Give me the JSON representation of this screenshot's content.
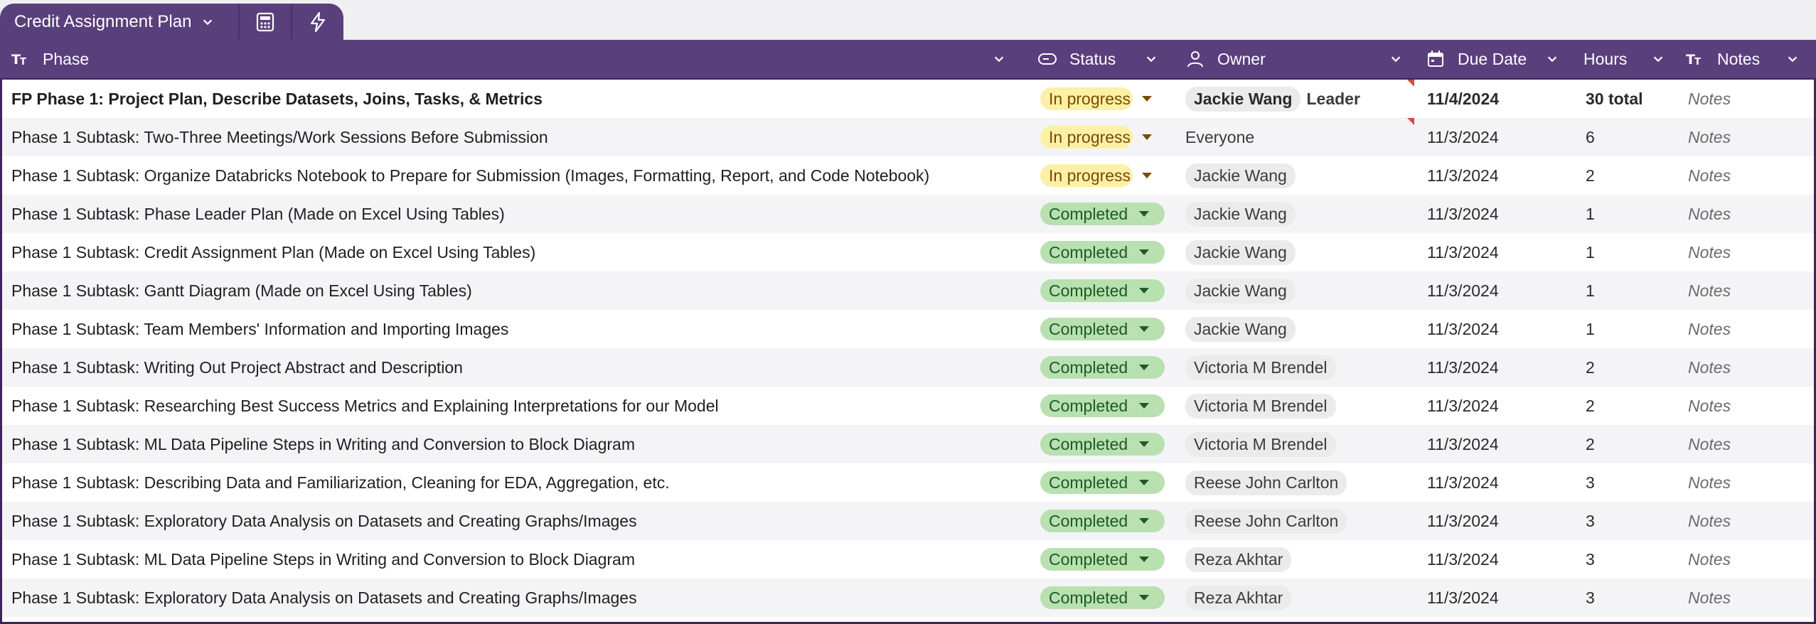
{
  "tab": {
    "title": "Credit Assignment Plan"
  },
  "columns": {
    "phase": "Phase",
    "status": "Status",
    "owner": "Owner",
    "due_date": "Due Date",
    "hours": "Hours",
    "notes": "Notes"
  },
  "colors": {
    "header_bg": "#5a3f7d",
    "in_progress_bg": "#fbf0a6",
    "completed_bg": "#b8e0b0"
  },
  "rows": [
    {
      "phase": "FP Phase 1: Project Plan, Describe Datasets, Joins, Tasks, & Metrics",
      "status": "In progress",
      "owner": "Jackie Wang",
      "owner_extra": "Leader",
      "due": "11/4/2024",
      "hours": "30 total",
      "notes": "Notes"
    },
    {
      "phase": "Phase 1 Subtask: Two-Three Meetings/Work Sessions Before Submission",
      "status": "In progress",
      "owner": "Everyone",
      "due": "11/3/2024",
      "hours": "6",
      "notes": "Notes"
    },
    {
      "phase": "Phase 1 Subtask: Organize Databricks Notebook to Prepare for Submission (Images, Formatting, Report, and Code Notebook)",
      "status": "In progress",
      "owner": "Jackie Wang",
      "due": "11/3/2024",
      "hours": "2",
      "notes": "Notes"
    },
    {
      "phase": "Phase 1 Subtask: Phase Leader Plan (Made on Excel Using Tables)",
      "status": "Completed",
      "owner": "Jackie Wang",
      "due": "11/3/2024",
      "hours": "1",
      "notes": "Notes"
    },
    {
      "phase": "Phase 1 Subtask: Credit Assignment Plan (Made on Excel Using Tables)",
      "status": "Completed",
      "owner": "Jackie Wang",
      "due": "11/3/2024",
      "hours": "1",
      "notes": "Notes"
    },
    {
      "phase": "Phase 1 Subtask: Gantt Diagram (Made on Excel Using Tables)",
      "status": "Completed",
      "owner": "Jackie Wang",
      "due": "11/3/2024",
      "hours": "1",
      "notes": "Notes"
    },
    {
      "phase": "Phase 1 Subtask: Team Members' Information and Importing Images",
      "status": "Completed",
      "owner": "Jackie Wang",
      "due": "11/3/2024",
      "hours": "1",
      "notes": "Notes"
    },
    {
      "phase": "Phase 1 Subtask: Writing Out Project Abstract and Description",
      "status": "Completed",
      "owner": "Victoria M Brendel",
      "due": "11/3/2024",
      "hours": "2",
      "notes": "Notes"
    },
    {
      "phase": "Phase 1 Subtask: Researching Best Success Metrics and Explaining Interpretations for our Model",
      "status": "Completed",
      "owner": "Victoria M Brendel",
      "due": "11/3/2024",
      "hours": "2",
      "notes": "Notes"
    },
    {
      "phase": "Phase 1 Subtask: ML Data Pipeline Steps in Writing and Conversion to Block Diagram",
      "status": "Completed",
      "owner": "Victoria M Brendel",
      "due": "11/3/2024",
      "hours": "2",
      "notes": "Notes"
    },
    {
      "phase": "Phase 1 Subtask: Describing Data and Familiarization, Cleaning for EDA, Aggregation, etc.",
      "status": "Completed",
      "owner": "Reese John Carlton",
      "due": "11/3/2024",
      "hours": "3",
      "notes": "Notes"
    },
    {
      "phase": "Phase 1 Subtask: Exploratory Data Analysis on Datasets and Creating Graphs/Images",
      "status": "Completed",
      "owner": "Reese John Carlton",
      "due": "11/3/2024",
      "hours": "3",
      "notes": "Notes"
    },
    {
      "phase": "Phase 1 Subtask: ML Data Pipeline Steps in Writing and Conversion to Block Diagram",
      "status": "Completed",
      "owner": "Reza Akhtar",
      "due": "11/3/2024",
      "hours": "3",
      "notes": "Notes"
    },
    {
      "phase": "Phase 1 Subtask: Exploratory Data Analysis on Datasets and Creating Graphs/Images",
      "status": "Completed",
      "owner": "Reza Akhtar",
      "due": "11/3/2024",
      "hours": "3",
      "notes": "Notes"
    }
  ]
}
